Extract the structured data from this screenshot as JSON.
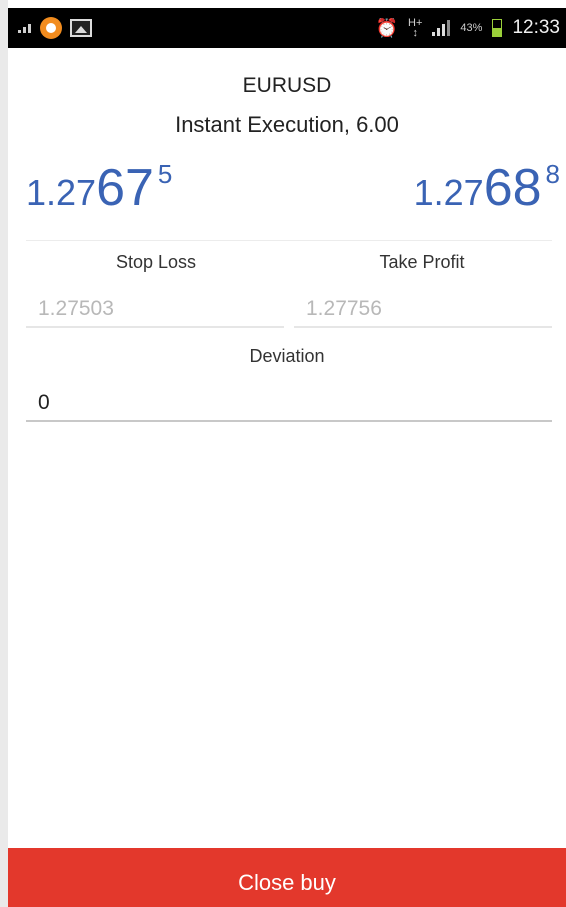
{
  "status_bar": {
    "icons_left": [
      "signal-small-icon",
      "app-notification-icon",
      "gallery-icon"
    ],
    "icons_right": [
      "alarm-icon",
      "hplus-network-icon",
      "signal-bars-icon",
      "battery-icon"
    ],
    "battery": "43%",
    "time": "12:33",
    "battery_color": "#9bd03a"
  },
  "order": {
    "symbol": "EURUSD",
    "execution": "Instant Execution, 6.00",
    "sell_price": {
      "prefix": "1.27",
      "big": "67",
      "sup": "5"
    },
    "buy_price": {
      "prefix": "1.27",
      "big": "68",
      "sup": "8"
    },
    "price_color": "#3a63b4"
  },
  "fields": {
    "stop_loss_label": "Stop Loss",
    "take_profit_label": "Take Profit",
    "stop_loss_value": "1.27503",
    "take_profit_value": "1.27756",
    "deviation_label": "Deviation",
    "deviation_value": "0"
  },
  "actions": {
    "close_buy_label": "Close buy",
    "close_buy_color": "#e3382c"
  }
}
